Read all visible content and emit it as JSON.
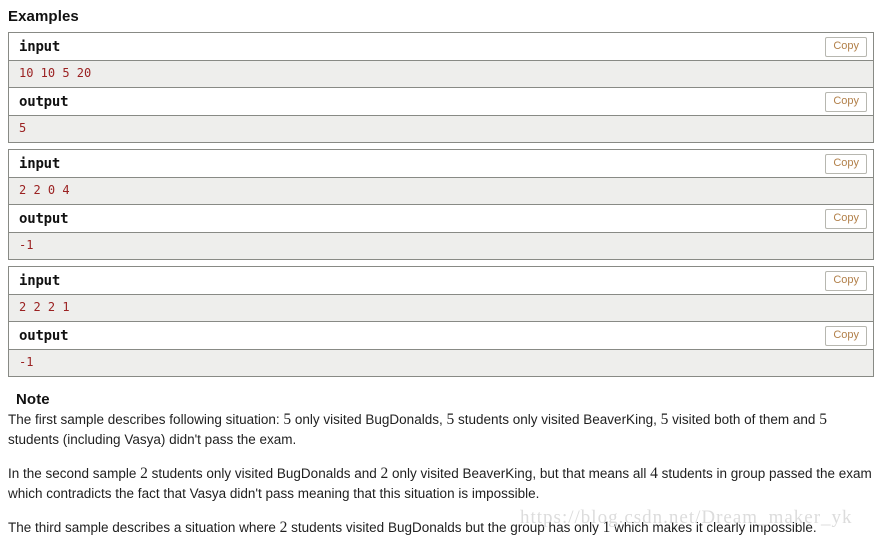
{
  "examples": {
    "heading": "Examples",
    "copy_label": "Copy",
    "input_label": "input",
    "output_label": "output",
    "tests": [
      {
        "input": "10 10 5 20",
        "output": "5"
      },
      {
        "input": "2 2 0 4",
        "output": "-1"
      },
      {
        "input": "2 2 2 1",
        "output": "-1"
      }
    ]
  },
  "note": {
    "heading": "Note",
    "paragraphs": [
      {
        "parts": [
          {
            "t": "The first sample describes following situation: ",
            "math": false
          },
          {
            "t": "5",
            "math": true
          },
          {
            "t": " only visited BugDonalds, ",
            "math": false
          },
          {
            "t": "5",
            "math": true
          },
          {
            "t": " students only visited BeaverKing, ",
            "math": false
          },
          {
            "t": "5",
            "math": true
          },
          {
            "t": " visited both of them and ",
            "math": false
          },
          {
            "t": "5",
            "math": true
          },
          {
            "t": " students (including Vasya) didn't pass the exam.",
            "math": false
          }
        ]
      },
      {
        "parts": [
          {
            "t": "In the second sample ",
            "math": false
          },
          {
            "t": "2",
            "math": true
          },
          {
            "t": " students only visited BugDonalds and ",
            "math": false
          },
          {
            "t": "2",
            "math": true
          },
          {
            "t": " only visited BeaverKing, but that means all ",
            "math": false
          },
          {
            "t": "4",
            "math": true
          },
          {
            "t": " students in group passed the exam which contradicts the fact that Vasya didn't pass meaning that this situation is impossible.",
            "math": false
          }
        ]
      },
      {
        "parts": [
          {
            "t": "The third sample describes a situation where ",
            "math": false
          },
          {
            "t": "2",
            "math": true
          },
          {
            "t": " students visited BugDonalds but the group has only ",
            "math": false
          },
          {
            "t": "1",
            "math": true
          },
          {
            "t": " which makes it clearly impossible.",
            "math": false
          }
        ]
      }
    ]
  },
  "watermark": {
    "text": "https://blog.csdn.net/Dream_maker_yk"
  },
  "colors": {
    "value_text": "#9b2222",
    "copy_text": "#b2804a",
    "border": "#888a85",
    "value_bg": "#eeeeec",
    "watermark": "#dcdcdc"
  }
}
